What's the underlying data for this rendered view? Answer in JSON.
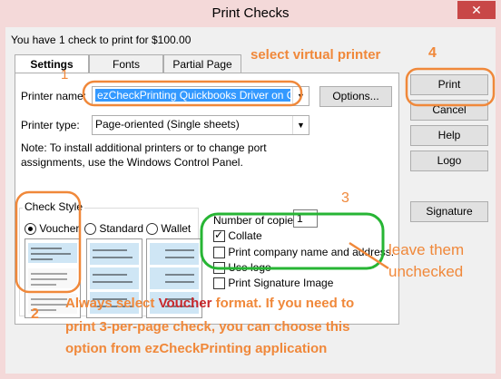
{
  "window": {
    "title": "Print Checks",
    "close_glyph": "✕"
  },
  "summary": "You have 1 check to print for $100.00",
  "tabs": [
    {
      "label": "Settings"
    },
    {
      "label": "Fonts"
    },
    {
      "label": "Partial Page"
    }
  ],
  "printer": {
    "name_label": "Printer name:",
    "name_value": "ezCheckPrinting Quickbooks Driver on Q...",
    "options_label": "Options...",
    "type_label": "Printer type:",
    "type_value": "Page-oriented (Single sheets)",
    "note": "Note: To install additional printers or to change port assignments, use the Windows Control Panel."
  },
  "check_style": {
    "group_label": "Check Style",
    "options": [
      {
        "label": "Voucher",
        "selected": true
      },
      {
        "label": "Standard",
        "selected": false
      },
      {
        "label": "Wallet",
        "selected": false
      }
    ]
  },
  "copies": {
    "label": "Number of copies:",
    "value": "1"
  },
  "checkboxes": [
    {
      "label": "Collate",
      "checked": true
    },
    {
      "label": "Print company name and address.",
      "checked": false
    },
    {
      "label": "Use logo",
      "checked": false
    },
    {
      "label": "Print Signature Image",
      "checked": false
    }
  ],
  "buttons": {
    "print": "Print",
    "cancel": "Cancel",
    "help": "Help",
    "logo": "Logo",
    "signature": "Signature"
  },
  "annotations": {
    "n1": "1",
    "select_virtual": "select virtual printer",
    "n2": "2",
    "n3": "3",
    "n4": "4",
    "leave_line1": "leave them",
    "leave_line2": "unchecked",
    "always_pre": "Always select ",
    "always_voucher": "Voucher",
    "always_post": " format. If you need to",
    "line2": "print 3-per-page check, you can choose this",
    "line3": "option from ezCheckPrinting application"
  },
  "colors": {
    "annotation_orange": "#f0883a",
    "annotation_green": "#27b534",
    "voucher_red": "#c8282c",
    "selection_blue": "#3399ff"
  }
}
